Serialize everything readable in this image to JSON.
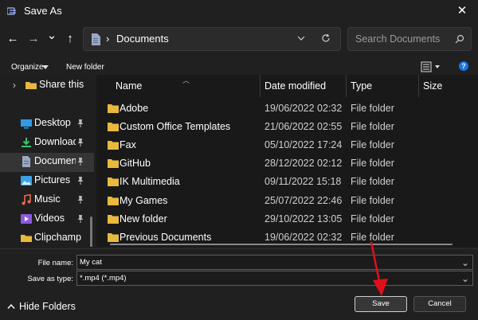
{
  "window": {
    "title": "Save As",
    "close_glyph": "✕"
  },
  "nav": {
    "back_glyph": "←",
    "forward_glyph": "→",
    "recent_glyph": "⌄",
    "up_glyph": "↑",
    "address_sep": "›",
    "address": "Documents",
    "search_placeholder": "Search Documents"
  },
  "toolbar": {
    "organize": "Organize",
    "new_folder": "New folder"
  },
  "sidebar": {
    "items": [
      {
        "label": "Share this",
        "icon": "folder-icon",
        "chevron": "›"
      },
      {
        "label": "Desktop",
        "icon": "desktop-icon"
      },
      {
        "label": "Downloads",
        "icon": "download-icon"
      },
      {
        "label": "Documents",
        "icon": "document-icon",
        "selected": true
      },
      {
        "label": "Pictures",
        "icon": "pictures-icon"
      },
      {
        "label": "Music",
        "icon": "music-icon"
      },
      {
        "label": "Videos",
        "icon": "videos-icon"
      },
      {
        "label": "Clipchamp",
        "icon": "folder-icon"
      }
    ]
  },
  "columns": {
    "name": "Name",
    "date": "Date modified",
    "type": "Type",
    "size": "Size"
  },
  "files": [
    {
      "name": "Adobe",
      "date": "19/06/2022 02:32",
      "type": "File folder"
    },
    {
      "name": "Custom Office Templates",
      "date": "21/06/2022 02:55",
      "type": "File folder"
    },
    {
      "name": "Fax",
      "date": "05/10/2022 17:24",
      "type": "File folder"
    },
    {
      "name": "GitHub",
      "date": "28/12/2022 02:12",
      "type": "File folder"
    },
    {
      "name": "IK Multimedia",
      "date": "09/11/2022 15:18",
      "type": "File folder"
    },
    {
      "name": "My Games",
      "date": "25/07/2022 22:46",
      "type": "File folder"
    },
    {
      "name": "New folder",
      "date": "29/10/2022 13:05",
      "type": "File folder"
    },
    {
      "name": "Previous Documents",
      "date": "19/06/2022 02:32",
      "type": "File folder"
    }
  ],
  "form": {
    "file_name_label": "File name:",
    "file_name_value": "My cat",
    "save_type_label": "Save as type:",
    "save_type_value": "*.mp4 (*.mp4)",
    "dropdown_glyph": "⌄"
  },
  "footer": {
    "hide_folders": "Hide Folders",
    "save": "Save",
    "cancel": "Cancel"
  },
  "colors": {
    "folder": "#e8b93c",
    "accent": "#1a73e8",
    "arrow": "#e0101a"
  }
}
